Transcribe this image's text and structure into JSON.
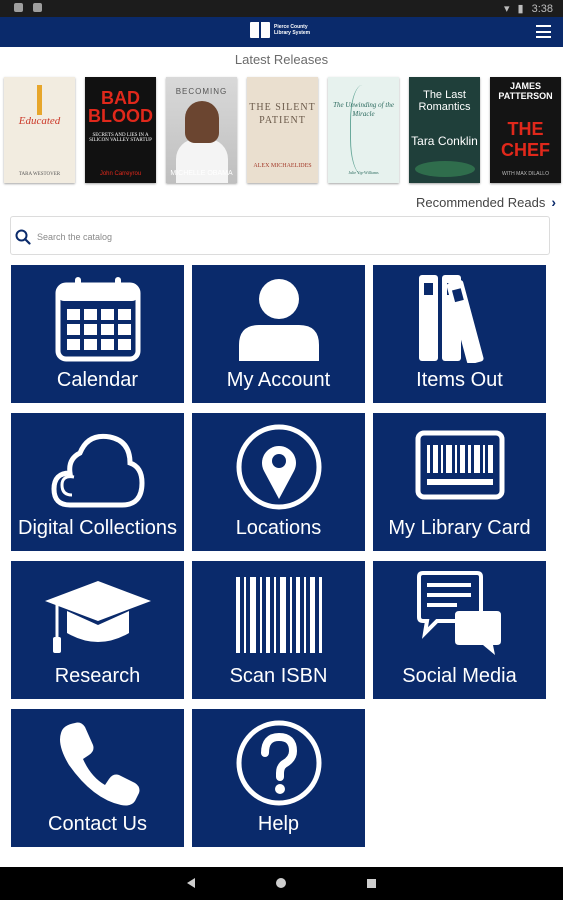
{
  "status_bar": {
    "time": "3:38"
  },
  "header": {
    "logo_text": "Pierce County Library System",
    "menu_icon": "hamburger-menu-icon"
  },
  "latest": {
    "title": "Latest Releases",
    "books": [
      {
        "title": "Educated",
        "author": "TARA WESTOVER",
        "subtitle": ""
      },
      {
        "title": "BAD BLOOD",
        "author": "John Carreyrou",
        "subtitle": "SECRETS AND LIES IN A SILICON VALLEY STARTUP"
      },
      {
        "title": "BECOMING",
        "author": "MICHELLE OBAMA",
        "subtitle": ""
      },
      {
        "title": "THE SILENT PATIENT",
        "author": "ALEX MICHAELIDES",
        "subtitle": ""
      },
      {
        "title": "The Unwinding of the Miracle",
        "author": "Julie Yip-Williams",
        "subtitle": ""
      },
      {
        "title": "The Last Romantics",
        "author": "Tara Conklin",
        "subtitle": ""
      },
      {
        "title": "THE CHEF",
        "author": "JAMES PATTERSON",
        "subtitle": "WITH MAX DILALLO"
      }
    ]
  },
  "recommended": {
    "label": "Recommended Reads"
  },
  "search": {
    "placeholder": "Search the catalog"
  },
  "tiles": [
    {
      "label": "Calendar",
      "icon": "calendar-icon"
    },
    {
      "label": "My Account",
      "icon": "person-icon"
    },
    {
      "label": "Items Out",
      "icon": "books-icon"
    },
    {
      "label": "Digital Collections",
      "icon": "cloud-icon"
    },
    {
      "label": "Locations",
      "icon": "map-pin-icon"
    },
    {
      "label": "My Library Card",
      "icon": "barcode-card-icon"
    },
    {
      "label": "Research",
      "icon": "graduation-cap-icon"
    },
    {
      "label": "Scan ISBN",
      "icon": "barcode-icon"
    },
    {
      "label": "Social Media",
      "icon": "chat-bubbles-icon"
    },
    {
      "label": "Contact Us",
      "icon": "phone-icon"
    },
    {
      "label": "Help",
      "icon": "question-icon"
    }
  ],
  "colors": {
    "brand": "#0a2a6b",
    "statusbar": "#1c1c1c",
    "navbar": "#000000"
  }
}
